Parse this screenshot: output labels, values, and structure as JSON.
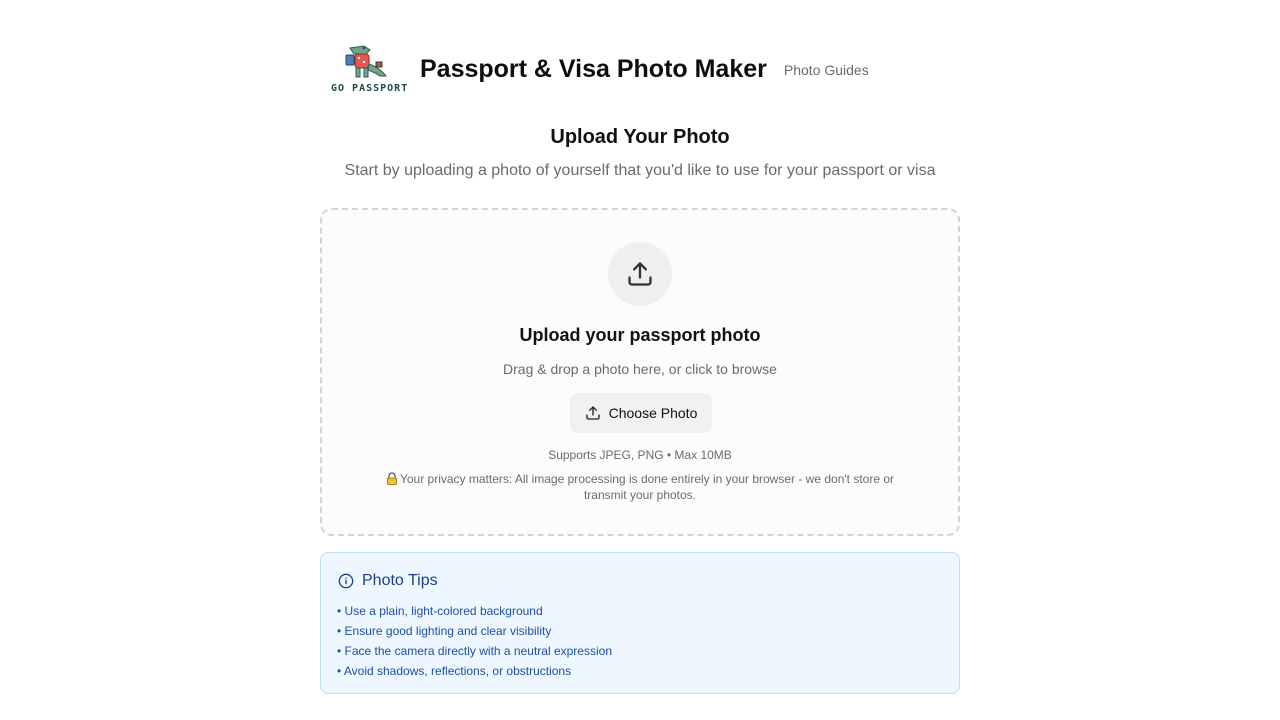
{
  "header": {
    "logo_text": "GO PASSPORT",
    "title": "Passport & Visa Photo Maker",
    "nav_link": "Photo Guides"
  },
  "upload_section": {
    "title": "Upload Your Photo",
    "subtitle": "Start by uploading a photo of yourself that you'd like to use for your passport or visa"
  },
  "dropzone": {
    "icon": "upload-icon",
    "title": "Upload your passport photo",
    "subtitle": "Drag & drop a photo here, or click to browse",
    "button_label": "Choose Photo",
    "formats": "Supports JPEG, PNG • Max 10MB",
    "privacy": "Your privacy matters: All image processing is done entirely in your browser - we don't store or transmit your photos."
  },
  "tips": {
    "icon": "info-icon",
    "title": "Photo Tips",
    "items": [
      "• Use a plain, light-colored background",
      "• Ensure good lighting and clear visibility",
      "• Face the camera directly with a neutral expression",
      "• Avoid shadows, reflections, or obstructions"
    ]
  },
  "colors": {
    "tips_background": "#eef6ff",
    "tips_border": "#bfdcf5",
    "tips_text": "#1e4fa3",
    "muted_text": "#6b6b6b"
  }
}
